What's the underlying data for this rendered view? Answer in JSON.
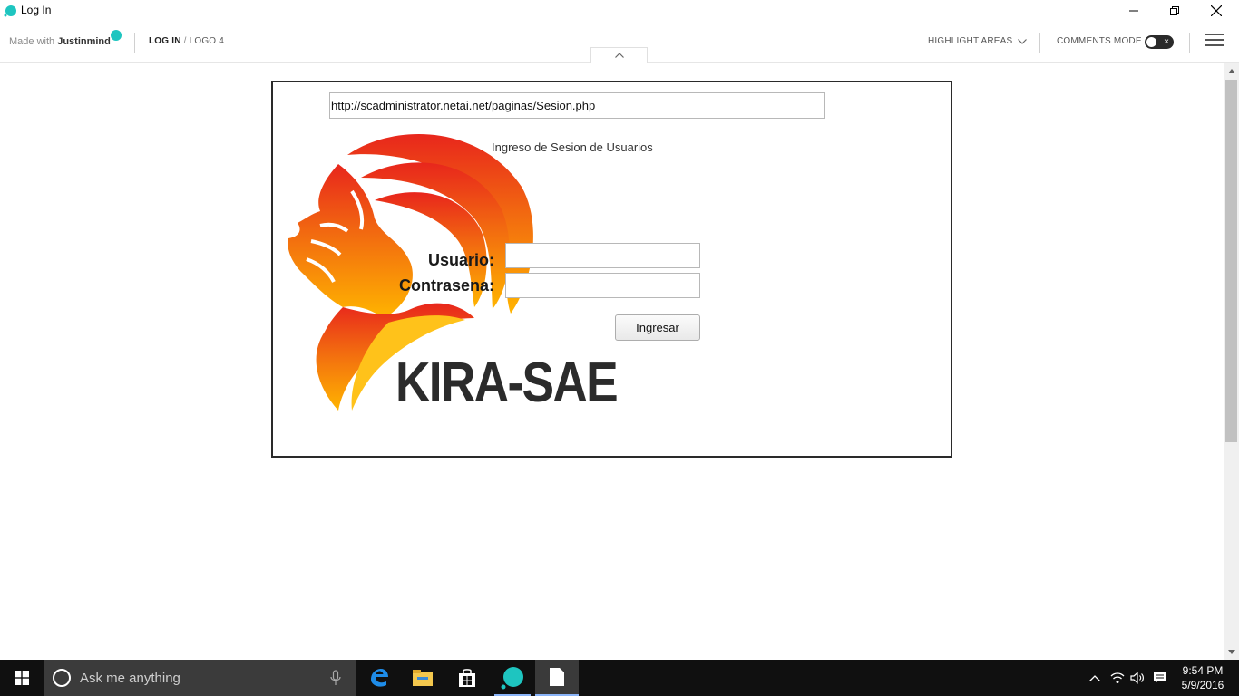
{
  "window": {
    "title": "Log In"
  },
  "toolbar": {
    "made_with_prefix": "Made with ",
    "made_with_brand": "Justinmind",
    "crumb_current": "LOG IN",
    "crumb_separator": " / ",
    "crumb_page": "LOGO 4",
    "highlight_areas": "HIGHLIGHT AREAS",
    "comments_mode": "COMMENTS MODE",
    "comments_toggle_on": false
  },
  "form": {
    "url": "http://scadministrator.netai.net/paginas/Sesion.php",
    "heading": "Ingreso de Sesion de Usuarios",
    "usuario_label": "Usuario:",
    "usuario_value": "",
    "contrasena_label": "Contrasena:",
    "contrasena_value": "",
    "submit_label": "Ingresar",
    "logo_text": "KIRA-SAE"
  },
  "taskbar": {
    "search_placeholder": "Ask me anything",
    "time": "9:54 PM",
    "date": "5/9/2016"
  },
  "colors": {
    "brand_accent": "#1ec5c0",
    "logo_gradient_top": "#e8261c",
    "logo_gradient_bottom": "#ffb400"
  }
}
